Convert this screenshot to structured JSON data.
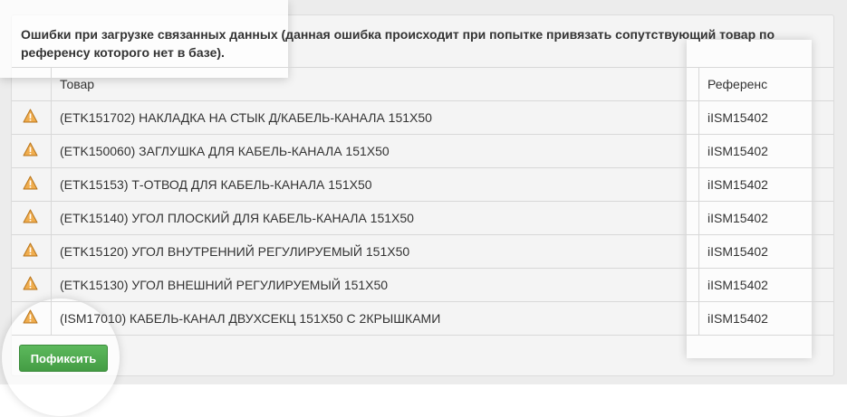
{
  "panel": {
    "title": "Ошибки при загрузке связанных данных (данная ошибка происходит при попытке привязать сопутствующий товар по референсу которого нет в базе)."
  },
  "table": {
    "headers": {
      "icon": "",
      "product": "Товар",
      "reference": "Референс"
    },
    "rows": [
      {
        "icon": "warning-icon",
        "product": "(ETK151702) НАКЛАДКА НА СТЫК Д/КАБЕЛЬ-КАНАЛА 151Х50",
        "reference": "iISM15402"
      },
      {
        "icon": "warning-icon",
        "product": "(ETK150060) ЗАГЛУШКА ДЛЯ КАБЕЛЬ-КАНАЛА 151Х50",
        "reference": "iISM15402"
      },
      {
        "icon": "warning-icon",
        "product": "(ETK15153) Т-ОТВОД ДЛЯ КАБЕЛЬ-КАНАЛА 151Х50",
        "reference": "iISM15402"
      },
      {
        "icon": "warning-icon",
        "product": "(ETK15140) УГОЛ ПЛОСКИЙ ДЛЯ КАБЕЛЬ-КАНАЛА 151Х50",
        "reference": "iISM15402"
      },
      {
        "icon": "warning-icon",
        "product": "(ETK15120) УГОЛ ВНУТРЕННИЙ РЕГУЛИРУЕМЫЙ 151Х50",
        "reference": "iISM15402"
      },
      {
        "icon": "warning-icon",
        "product": "(ETK15130) УГОЛ ВНЕШНИЙ РЕГУЛИРУЕМЫЙ 151Х50",
        "reference": "iISM15402"
      },
      {
        "icon": "warning-icon",
        "product": "(ISM17010) КАБЕЛЬ-КАНАЛ ДВУХСЕКЦ 151Х50 С 2КРЫШКАМИ",
        "reference": "iISM15402"
      }
    ]
  },
  "actions": {
    "fix_label": "Пофиксить"
  },
  "colors": {
    "warning": "#f0ad4e",
    "button": "#4cae4c"
  }
}
